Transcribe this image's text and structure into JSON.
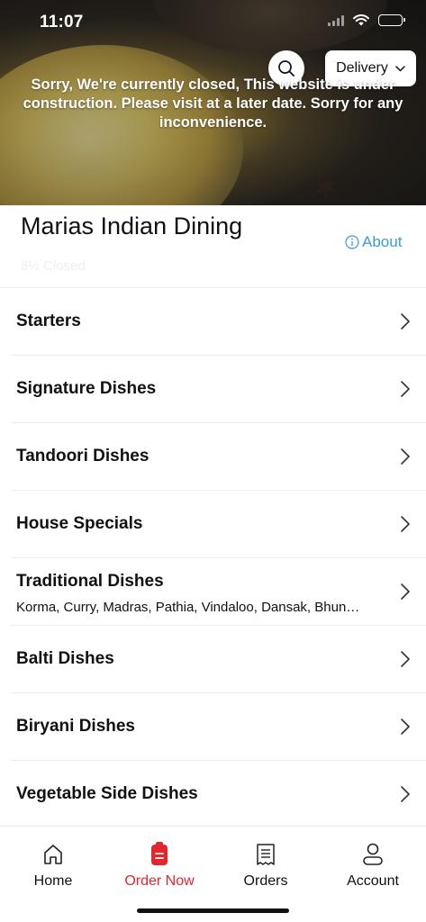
{
  "status_bar": {
    "time": "11:07"
  },
  "hero": {
    "search_icon": "search-icon",
    "delivery_label": "Delivery",
    "closed_message": "Sorry, We're currently closed, This website is under construction. Please visit at a later date. Sorry for any inconvenience."
  },
  "restaurant": {
    "name": "Marias Indian Dining",
    "about_label": "About",
    "status": "8½ Closed"
  },
  "menu": {
    "items": [
      {
        "label": "Starters"
      },
      {
        "label": "Signature Dishes"
      },
      {
        "label": "Tandoori Dishes"
      },
      {
        "label": "House Specials"
      },
      {
        "label": "Traditional Dishes",
        "subtitle": "Korma, Curry, Madras, Pathia, Vindaloo, Dansak, Bhun…"
      },
      {
        "label": "Balti Dishes"
      },
      {
        "label": "Biryani Dishes"
      },
      {
        "label": "Vegetable Side Dishes"
      }
    ]
  },
  "bottom_nav": {
    "items": [
      {
        "label": "Home",
        "icon": "home-icon"
      },
      {
        "label": "Order Now",
        "icon": "order-icon"
      },
      {
        "label": "Orders",
        "icon": "receipt-icon"
      },
      {
        "label": "Account",
        "icon": "account-icon"
      }
    ],
    "active": "Order Now"
  },
  "colors": {
    "accent": "#e3262b",
    "link": "#3a9bd1"
  }
}
